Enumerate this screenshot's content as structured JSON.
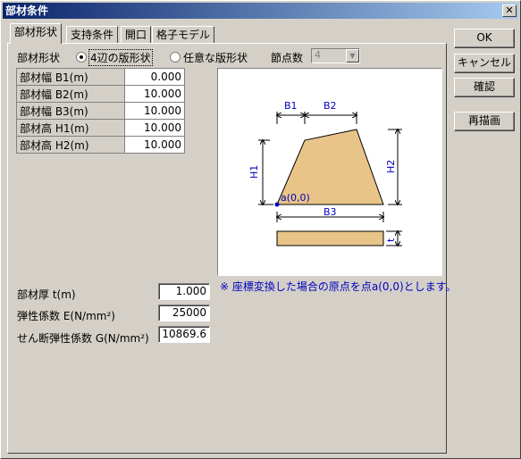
{
  "window": {
    "title": "部材条件",
    "close": "✕"
  },
  "tabs": [
    {
      "label": "部材形状"
    },
    {
      "label": "支持条件"
    },
    {
      "label": "開口"
    },
    {
      "label": "格子モデル"
    }
  ],
  "buttons": {
    "ok": "OK",
    "cancel": "キャンセル",
    "confirm": "確認",
    "redraw": "再描画"
  },
  "shape": {
    "label": "部材形状",
    "option1": "4辺の版形状",
    "option2": "任意な版形状",
    "nodes_label": "節点数",
    "nodes_value": "4"
  },
  "params": [
    {
      "key": "部材幅 B1(m)",
      "value": "0.000"
    },
    {
      "key": "部材幅 B2(m)",
      "value": "10.000"
    },
    {
      "key": "部材幅 B3(m)",
      "value": "10.000"
    },
    {
      "key": "部材高 H1(m)",
      "value": "10.000"
    },
    {
      "key": "部材高 H2(m)",
      "value": "10.000"
    }
  ],
  "props": {
    "thickness_label": "部材厚  t(m)",
    "thickness_value": "1.000",
    "elastic_label": "弾性係数  E(N/mm²)",
    "elastic_value": "25000",
    "shear_label": "せん断弾性係数  G(N/mm²)",
    "shear_value": "10869.6"
  },
  "diagram": {
    "b1": "B1",
    "b2": "B2",
    "b3": "B3",
    "h1": "H1",
    "h2": "H2",
    "t": "t",
    "origin": "a(0,0)",
    "fill": "#e8c489",
    "accent": "#0000c0"
  },
  "note": "※ 座標変換した場合の原点を点a(0,0)とします。"
}
